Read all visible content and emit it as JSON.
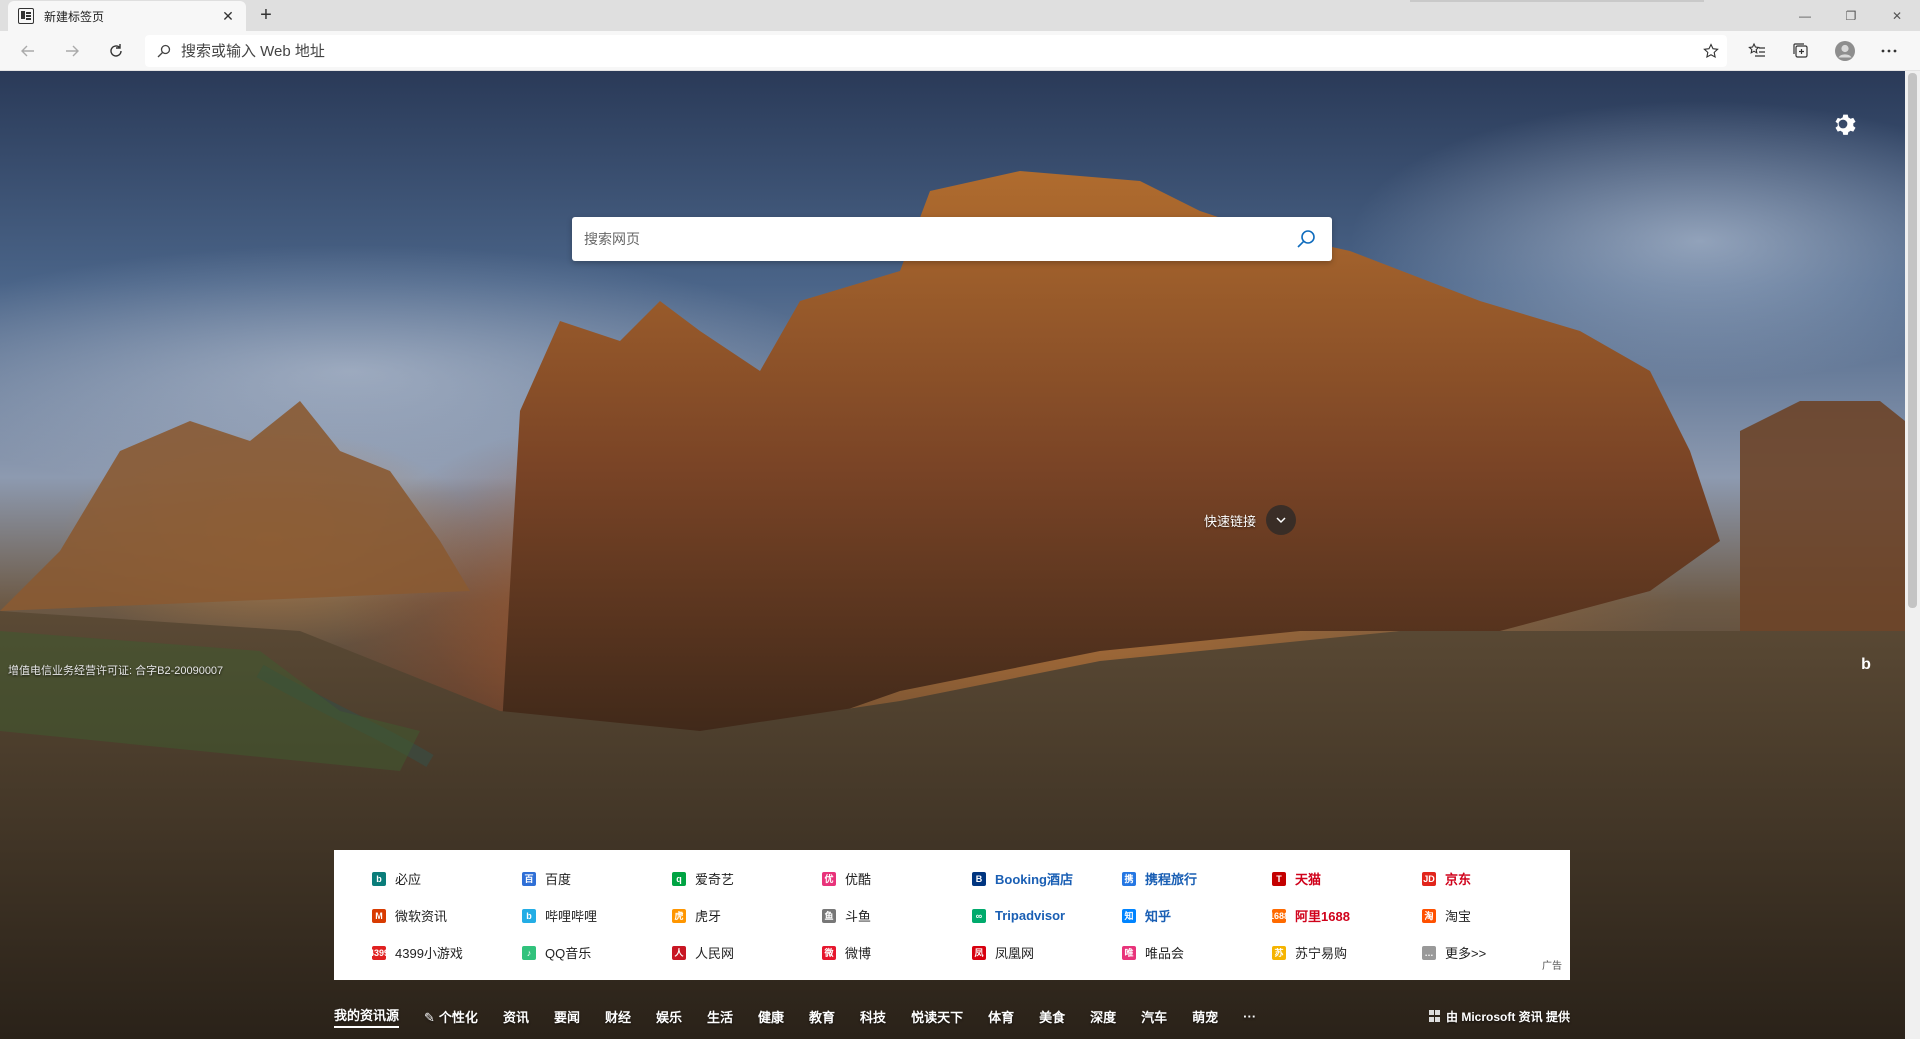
{
  "browser": {
    "tab_title": "新建标签页",
    "tab_close": "✕",
    "new_tab": "+",
    "window_controls": {
      "minimize": "—",
      "maximize": "❐",
      "close": "✕"
    },
    "address_placeholder": "搜索或输入 Web 地址"
  },
  "page": {
    "search_placeholder": "搜索网页",
    "quick_links_label": "快速链接",
    "license_text": "增值电信业务经营许可证: 合字B2-20090007",
    "bing_label": "b"
  },
  "links": {
    "items": [
      {
        "label": "必应",
        "color": "#0a7d7a",
        "glyph": "b",
        "brand": false
      },
      {
        "label": "百度",
        "color": "#2f6fd6",
        "glyph": "百",
        "brand": false
      },
      {
        "label": "爱奇艺",
        "color": "#00a443",
        "glyph": "q",
        "brand": false
      },
      {
        "label": "优酷",
        "color": "#e8337a",
        "glyph": "优",
        "brand": false
      },
      {
        "label": "Booking酒店",
        "color": "#003580",
        "glyph": "B",
        "brand": true,
        "text_color": "#1a5fb4"
      },
      {
        "label": "携程旅行",
        "color": "#2577e3",
        "glyph": "携",
        "brand": true,
        "text_color": "#1a5fb4"
      },
      {
        "label": "天猫",
        "color": "#c40000",
        "glyph": "T",
        "brand": true,
        "text_color": "#d0021b"
      },
      {
        "label": "京东",
        "color": "#e1251b",
        "glyph": "JD",
        "brand": true,
        "text_color": "#d0021b"
      },
      {
        "label": "微软资讯",
        "color": "#d83b01",
        "glyph": "M",
        "brand": false
      },
      {
        "label": "哔哩哔哩",
        "color": "#23ade5",
        "glyph": "b",
        "brand": false
      },
      {
        "label": "虎牙",
        "color": "#ff9600",
        "glyph": "虎",
        "brand": false
      },
      {
        "label": "斗鱼",
        "color": "#777777",
        "glyph": "鱼",
        "brand": false
      },
      {
        "label": "Tripadvisor",
        "color": "#00aa6c",
        "glyph": "∞",
        "brand": true,
        "text_color": "#1a5fb4"
      },
      {
        "label": "知乎",
        "color": "#0084ff",
        "glyph": "知",
        "brand": true,
        "text_color": "#1a5fb4"
      },
      {
        "label": "阿里1688",
        "color": "#ff6a00",
        "glyph": "1688",
        "brand": true,
        "text_color": "#d0021b"
      },
      {
        "label": "淘宝",
        "color": "#ff5000",
        "glyph": "淘",
        "brand": false
      },
      {
        "label": "4399小游戏",
        "color": "#e02020",
        "glyph": "4399",
        "brand": false
      },
      {
        "label": "QQ音乐",
        "color": "#31c27c",
        "glyph": "♪",
        "brand": false
      },
      {
        "label": "人民网",
        "color": "#c81623",
        "glyph": "人",
        "brand": false
      },
      {
        "label": "微博",
        "color": "#e6162d",
        "glyph": "微",
        "brand": false
      },
      {
        "label": "凤凰网",
        "color": "#d7000f",
        "glyph": "凤",
        "brand": false
      },
      {
        "label": "唯品会",
        "color": "#e8337a",
        "glyph": "唯",
        "brand": false
      },
      {
        "label": "苏宁易购",
        "color": "#f5b400",
        "glyph": "苏",
        "brand": false
      },
      {
        "label": "更多>>",
        "color": "#999999",
        "glyph": "…",
        "brand": false
      }
    ],
    "ad_label": "广告"
  },
  "news_nav": {
    "items": [
      "我的资讯源",
      "个性化",
      "资讯",
      "要闻",
      "财经",
      "娱乐",
      "生活",
      "健康",
      "教育",
      "科技",
      "悦读天下",
      "体育",
      "美食",
      "深度",
      "汽车",
      "萌宠",
      "···"
    ],
    "provider": "由 Microsoft 资讯 提供"
  }
}
